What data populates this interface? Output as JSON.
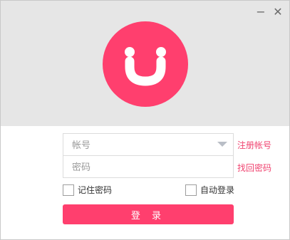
{
  "window": {
    "minimize_glyph": "−",
    "close_glyph": "✕"
  },
  "login": {
    "account_placeholder": "帐号",
    "password_placeholder": "密码",
    "register_link": "注册帐号",
    "recover_link": "找回密码",
    "remember_label": "记住密码",
    "auto_login_label": "自动登录",
    "login_button": "登 录"
  },
  "colors": {
    "accent": "#ff3f6e",
    "link": "#f04470",
    "header_bg": "#e6e6e6"
  },
  "icons": {
    "avatar": "smiley-face-icon",
    "dropdown": "chevron-down-icon"
  }
}
